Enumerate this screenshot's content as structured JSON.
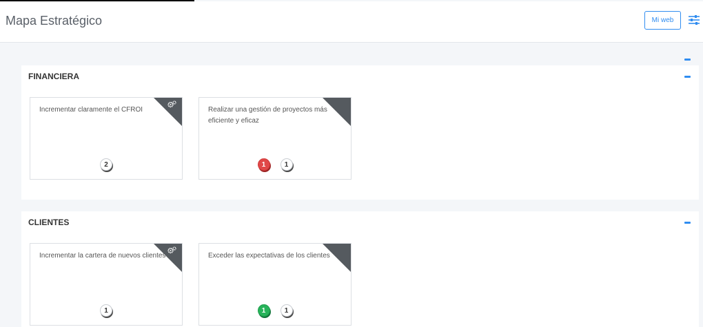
{
  "page_title": "Mapa Estratégico",
  "header": {
    "mi_web_label": "Mi web"
  },
  "icons": [
    "settings-sliders-icon",
    "gears-icon",
    "minus-icon"
  ],
  "colors": {
    "accent": "#2f8cf0",
    "badge_red": "#e04848",
    "badge_green": "#27b35a",
    "corner": "#555a5f"
  },
  "sections": [
    {
      "title": "FINANCIERA",
      "cards": [
        {
          "text": "Incrementar claramente el CFROI",
          "gears_icon": true,
          "badges": [
            {
              "value": "2",
              "color": "white"
            }
          ]
        },
        {
          "text": "Realizar una gestión de proyectos más eficiente y eficaz",
          "gears_icon": false,
          "badges": [
            {
              "value": "1",
              "color": "red"
            },
            {
              "value": "1",
              "color": "white"
            }
          ]
        }
      ]
    },
    {
      "title": "CLIENTES",
      "cards": [
        {
          "text": "Incrementar la cartera de nuevos clientes",
          "gears_icon": true,
          "badges": [
            {
              "value": "1",
              "color": "white"
            }
          ]
        },
        {
          "text": "Exceder las expectativas de los clientes",
          "gears_icon": false,
          "badges": [
            {
              "value": "1",
              "color": "green"
            },
            {
              "value": "1",
              "color": "white"
            }
          ]
        }
      ]
    }
  ]
}
